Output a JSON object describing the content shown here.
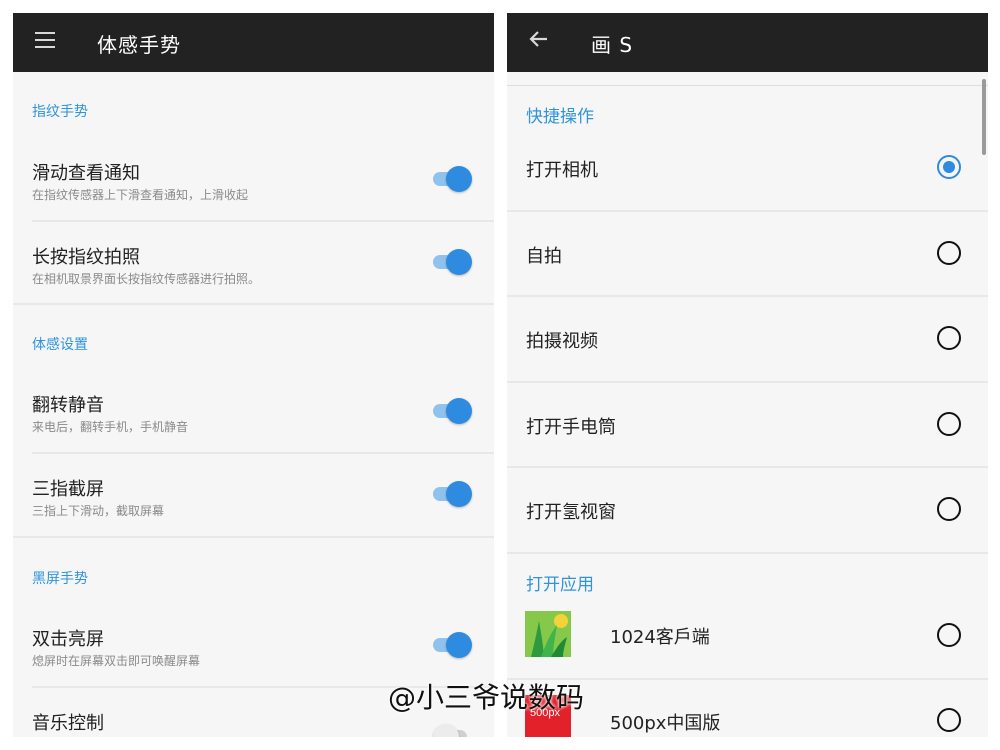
{
  "left": {
    "title": "体感手势",
    "sections": {
      "fingerprint": "指纹手势",
      "motion": "体感设置",
      "blank_screen": "黑屏手势"
    },
    "items": [
      {
        "title": "滑动查看通知",
        "subtitle": "在指纹传感器上下滑查看通知，上滑收起",
        "enabled": true
      },
      {
        "title": "长按指纹拍照",
        "subtitle": "在相机取景界面长按指纹传感器进行拍照。",
        "enabled": true
      },
      {
        "title": "翻转静音",
        "subtitle": "来电后，翻转手机，手机静音",
        "enabled": true
      },
      {
        "title": "三指截屏",
        "subtitle": "三指上下滑动，截取屏幕",
        "enabled": true
      },
      {
        "title": "双击亮屏",
        "subtitle": "熄屏时在屏幕双击即可唤醒屏幕",
        "enabled": true
      },
      {
        "title": "音乐控制",
        "subtitle": "",
        "enabled": false
      }
    ]
  },
  "right": {
    "title": "画 S",
    "sections": {
      "quick_actions": "快捷操作",
      "open_app": "打开应用"
    },
    "quick_actions": [
      {
        "label": "打开相机",
        "selected": true
      },
      {
        "label": "自拍",
        "selected": false
      },
      {
        "label": "拍摄视频",
        "selected": false
      },
      {
        "label": "打开手电筒",
        "selected": false
      },
      {
        "label": "打开氢视窗",
        "selected": false
      }
    ],
    "apps": [
      {
        "label": "1024客戶端",
        "icon": "1024-app-icon",
        "selected": false
      },
      {
        "label": "500px中国版",
        "icon": "500px-app-icon",
        "icon_text": "500px",
        "selected": false
      }
    ]
  },
  "watermark": "@小三爷说数码",
  "colors": {
    "accent": "#2e8be0",
    "appbar": "#222222",
    "background": "#f6f6f6"
  }
}
